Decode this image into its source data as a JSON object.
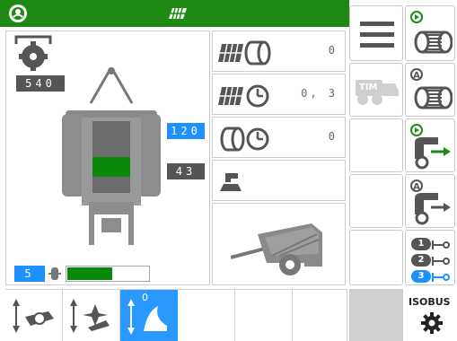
{
  "header": {
    "left_icon": "power-status-icon",
    "center_icon": "field-grid-icon"
  },
  "left_panel": {
    "pto_speed": "540",
    "bale_value_blue": "120",
    "bale_value_gray": "43",
    "fill_level_label": "5",
    "fill_level_fraction": 0.55
  },
  "counters": [
    {
      "icon": "field-bale-counter-icon",
      "value": "0"
    },
    {
      "icon": "field-time-icon",
      "value": "0, 3"
    },
    {
      "icon": "bale-time-icon",
      "value": "0"
    },
    {
      "icon": "ground-position-icon",
      "value": ""
    }
  ],
  "right_column": {
    "menu_icon": "menu-icon",
    "tim_label": "TIM",
    "net_buttons": [
      "manual-net-wrap-icon",
      "auto-net-wrap-icon",
      "manual-eject-icon",
      "auto-eject-icon"
    ],
    "layers": [
      "1",
      "2",
      "3"
    ]
  },
  "bottom_bar": {
    "knife_label": "0",
    "isobus_label": "ISOBUS"
  },
  "colors": {
    "brand_green": "#1e8a14",
    "accent_blue": "#1e90ff",
    "panel_gray": "#cfcfcf"
  }
}
